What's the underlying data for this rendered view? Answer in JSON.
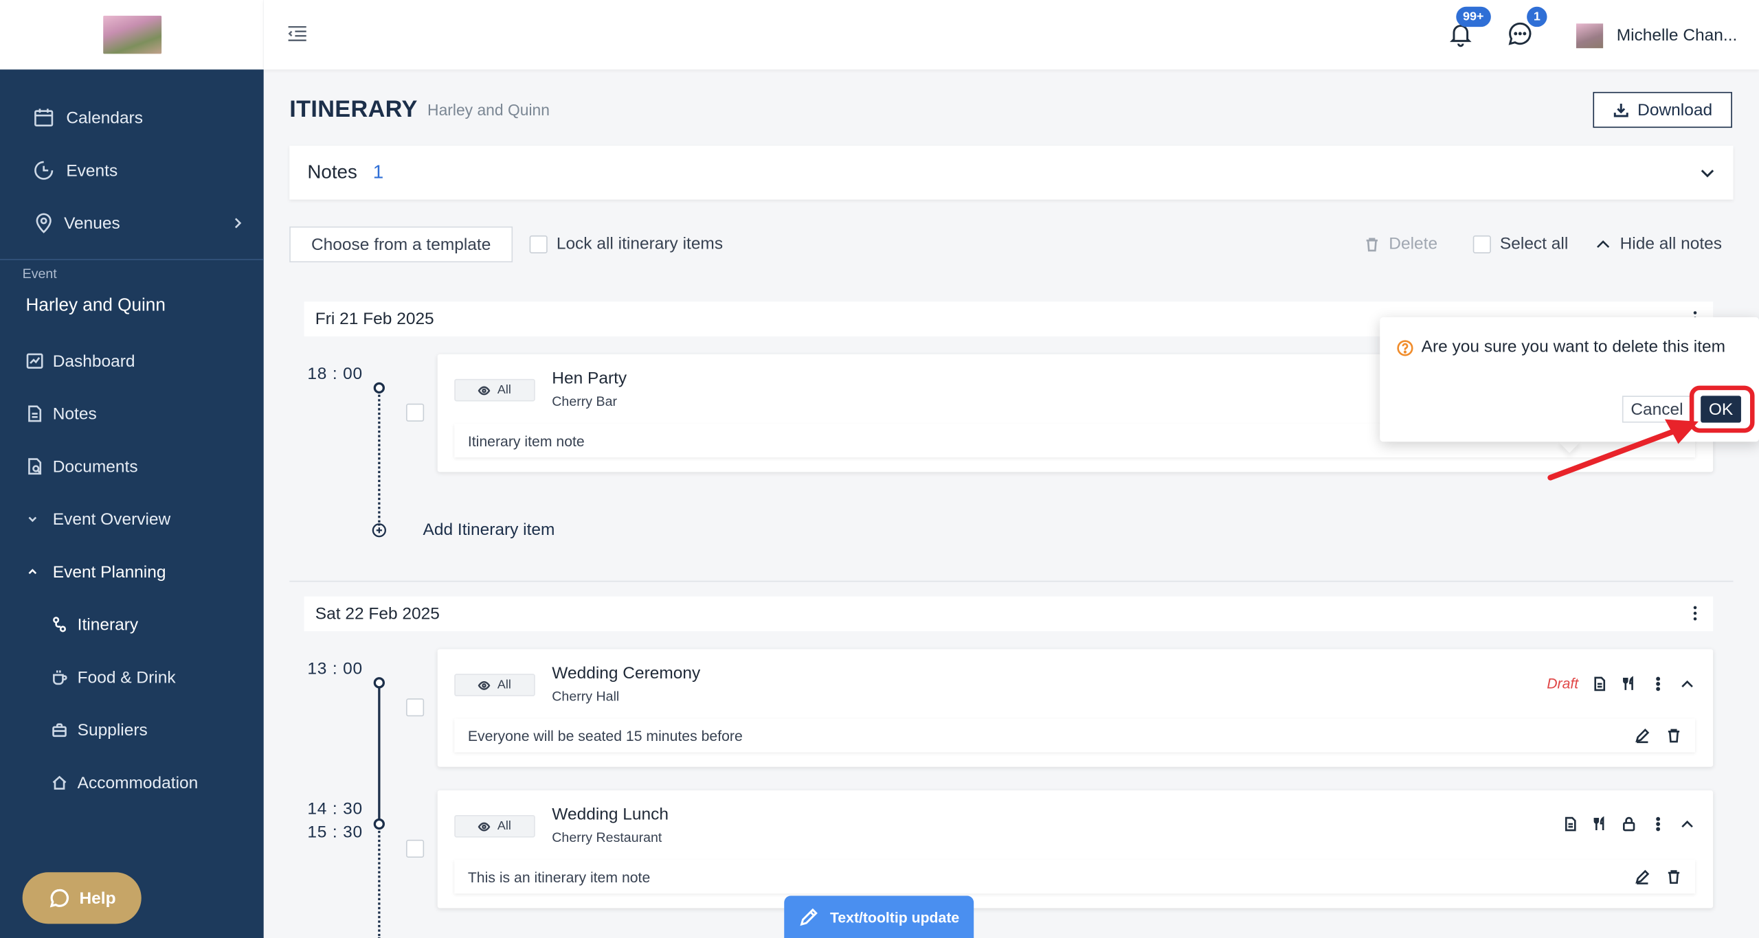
{
  "sidebar": {
    "nav": [
      {
        "label": "Calendars",
        "icon": "calendar-icon"
      },
      {
        "label": "Events",
        "icon": "events-icon"
      },
      {
        "label": "Venues",
        "icon": "location-pin-icon"
      }
    ],
    "section_label": "Event",
    "event_name": "Harley and Quinn",
    "event_nav": [
      {
        "label": "Dashboard",
        "icon": "dashboard-icon"
      },
      {
        "label": "Notes",
        "icon": "notes-icon"
      },
      {
        "label": "Documents",
        "icon": "documents-icon"
      },
      {
        "label": "Event Overview",
        "icon": "chevron-down-icon"
      },
      {
        "label": "Event Planning",
        "icon": "chevron-up-icon"
      }
    ],
    "planning_nav": [
      {
        "label": "Itinerary",
        "icon": "itinerary-icon"
      },
      {
        "label": "Food & Drink",
        "icon": "coffee-cup-icon"
      },
      {
        "label": "Suppliers",
        "icon": "briefcase-icon"
      },
      {
        "label": "Accommodation",
        "icon": "home-icon"
      }
    ],
    "help_label": "Help"
  },
  "topbar": {
    "notifications_badge": "99+",
    "messages_badge": "1",
    "user_name": "Michelle Chan..."
  },
  "page": {
    "title": "ITINERARY",
    "subtitle": "Harley and Quinn",
    "download_label": "Download"
  },
  "notes": {
    "label": "Notes",
    "count": "1"
  },
  "toolbar": {
    "template_label": "Choose from a template",
    "lock_label": "Lock all itinerary items",
    "delete_label": "Delete",
    "select_all_label": "Select all",
    "hide_notes_label": "Hide all notes"
  },
  "days": [
    {
      "date": "Fri 21 Feb 2025",
      "items": [
        {
          "time": "18 : 00",
          "visibility": "All",
          "title": "Hen Party",
          "venue": "Cherry Bar",
          "note": "Itinerary item note"
        }
      ],
      "add_label": "Add Itinerary item"
    },
    {
      "date": "Sat 22 Feb 2025",
      "items": [
        {
          "time": "13 : 00",
          "visibility": "All",
          "title": "Wedding Ceremony",
          "venue": "Cherry Hall",
          "status": "Draft",
          "note": "Everyone will be seated 15 minutes before"
        },
        {
          "time": "14 : 30",
          "time_end": "15 : 30",
          "visibility": "All",
          "title": "Wedding Lunch",
          "venue": "Cherry Restaurant",
          "note": "This is an itinerary item note"
        }
      ]
    }
  ],
  "popconfirm": {
    "message": "Are you sure you want to delete this item",
    "cancel_label": "Cancel",
    "ok_label": "OK"
  },
  "toast": {
    "label": "Text/tooltip update"
  },
  "colors": {
    "sidebar_bg": "#1d3a5c",
    "primary": "#1c2f4a",
    "accent_blue": "#2f6fd6",
    "help_gold": "#c6a567",
    "draft_red": "#e04747",
    "annotation_red": "#e8232a",
    "toast_blue": "#4a8ff0"
  }
}
